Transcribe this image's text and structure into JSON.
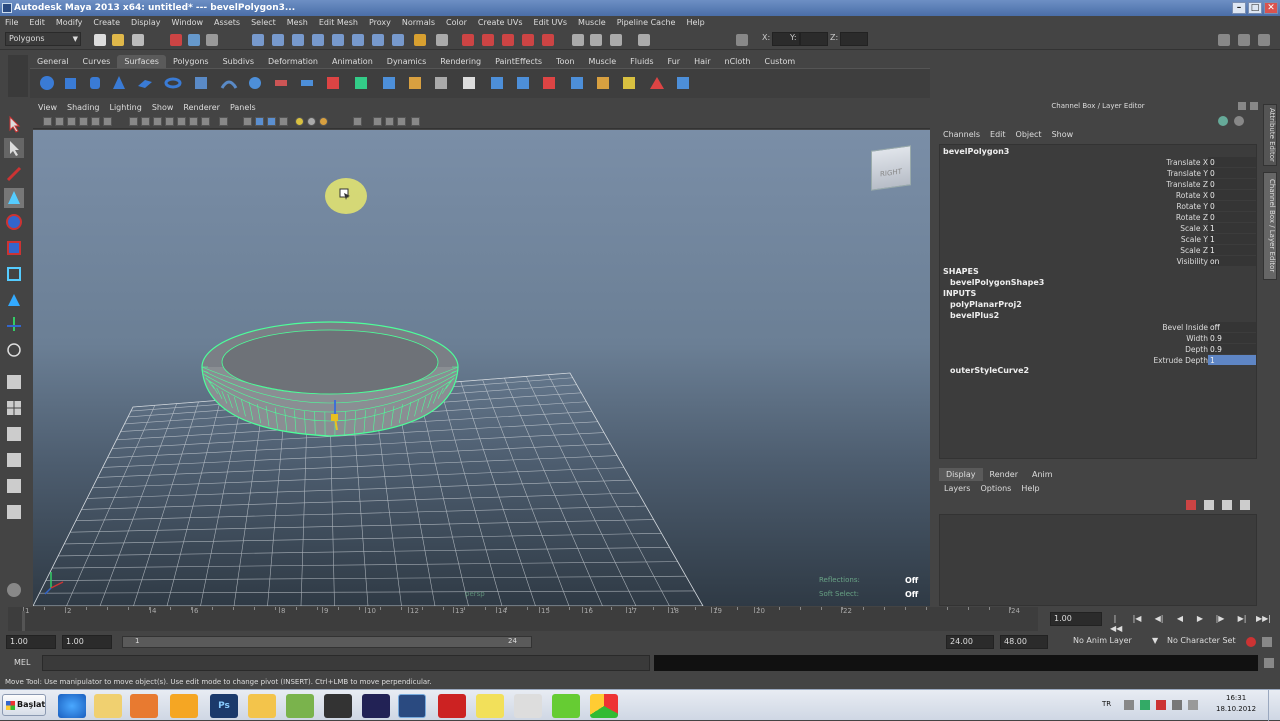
{
  "window": {
    "title": "Autodesk Maya 2013 x64: untitled*   ---   bevelPolygon3...",
    "controls": [
      "–",
      "□",
      "✕"
    ]
  },
  "menubar": [
    "File",
    "Edit",
    "Modify",
    "Create",
    "Display",
    "Window",
    "Assets",
    "Select",
    "Mesh",
    "Edit Mesh",
    "Proxy",
    "Normals",
    "Color",
    "Create UVs",
    "Edit UVs",
    "Muscle",
    "Pipeline Cache",
    "Help"
  ],
  "statusline": {
    "mode": "Polygons",
    "x_label": "X:",
    "y_label": "Y:",
    "z_label": "Z:"
  },
  "shelf": {
    "tabs": [
      "General",
      "Curves",
      "Surfaces",
      "Polygons",
      "Subdivs",
      "Deformation",
      "Animation",
      "Dynamics",
      "Rendering",
      "PaintEffects",
      "Toon",
      "Muscle",
      "Fluids",
      "Fur",
      "Hair",
      "nCloth",
      "Custom"
    ],
    "active_tab": "Surfaces"
  },
  "panel": {
    "menu": [
      "View",
      "Shading",
      "Lighting",
      "Show",
      "Renderer",
      "Panels"
    ],
    "viewcube_label": "RIGHT",
    "camera_label": "persp",
    "hud": [
      {
        "label": "Reflections:",
        "value": "Off"
      },
      {
        "label": "Soft Select:",
        "value": "Off"
      }
    ]
  },
  "channel_box": {
    "title": "Channel Box / Layer Editor",
    "menu": [
      "Channels",
      "Edit",
      "Object",
      "Show"
    ],
    "object_name": "bevelPolygon3",
    "transforms": [
      {
        "label": "Translate X",
        "value": "0"
      },
      {
        "label": "Translate Y",
        "value": "0"
      },
      {
        "label": "Translate Z",
        "value": "0"
      },
      {
        "label": "Rotate X",
        "value": "0"
      },
      {
        "label": "Rotate Y",
        "value": "0"
      },
      {
        "label": "Rotate Z",
        "value": "0"
      },
      {
        "label": "Scale X",
        "value": "1"
      },
      {
        "label": "Scale Y",
        "value": "1"
      },
      {
        "label": "Scale Z",
        "value": "1"
      },
      {
        "label": "Visibility",
        "value": "on"
      }
    ],
    "shapes_header": "SHAPES",
    "shape_name": "bevelPolygonShape3",
    "inputs_header": "INPUTS",
    "inputs": [
      "polyPlanarProj2",
      "bevelPlus2"
    ],
    "bevel_attrs": [
      {
        "label": "Bevel Inside",
        "value": "off"
      },
      {
        "label": "Width",
        "value": "0.9"
      },
      {
        "label": "Depth",
        "value": "0.9"
      },
      {
        "label": "Extrude Depth",
        "value": "1"
      }
    ],
    "extra_input": "outerStyleCurve2"
  },
  "side_tabs": [
    "Attribute Editor",
    "Channel Box / Layer Editor"
  ],
  "layer_editor": {
    "tabs": [
      "Display",
      "Render",
      "Anim"
    ],
    "active_tab": "Display",
    "menu": [
      "Layers",
      "Options",
      "Help"
    ]
  },
  "time_slider": {
    "tick_labels": [
      "1",
      "2",
      "4",
      "6",
      "8",
      "9",
      "10",
      "12",
      "13",
      "14",
      "15",
      "16",
      "17",
      "18",
      "19",
      "20",
      "22",
      "24"
    ],
    "current_frame": "1.00",
    "playback_buttons": [
      "|◀◀",
      "|◀",
      "◀|",
      "◀",
      "▶",
      "|▶",
      "▶|",
      "▶▶|"
    ]
  },
  "range_slider": {
    "start": "1.00",
    "playback_start": "1.00",
    "range_start_label": "1",
    "range_end_label": "24",
    "playback_end": "24.00",
    "end": "48.00",
    "anim_layer": "No Anim Layer",
    "character_set": "No Character Set"
  },
  "command_line": {
    "label": "MEL"
  },
  "help_line": "Move Tool: Use manipulator to move object(s). Use edit mode to change pivot (INSERT). Ctrl+LMB to move perpendicular.",
  "taskbar": {
    "start_label": "Başlat",
    "language": "TR",
    "time": "16:31",
    "date": "18.10.2012"
  }
}
